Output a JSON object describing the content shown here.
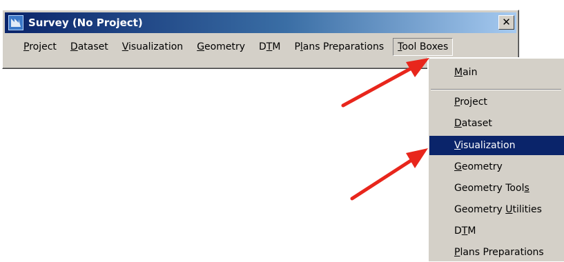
{
  "window": {
    "title": "Survey (No Project)",
    "close_glyph": "✕"
  },
  "menubar": {
    "items": [
      {
        "pre": "",
        "key": "P",
        "post": "roject"
      },
      {
        "pre": "",
        "key": "D",
        "post": "ataset"
      },
      {
        "pre": "",
        "key": "V",
        "post": "isualization"
      },
      {
        "pre": "",
        "key": "G",
        "post": "eometry"
      },
      {
        "pre": "D",
        "key": "T",
        "post": "M"
      },
      {
        "pre": "P",
        "key": "l",
        "post": "ans Preparations"
      },
      {
        "pre": "",
        "key": "T",
        "post": "ool Boxes"
      }
    ]
  },
  "dropdown": {
    "items": [
      {
        "pre": "",
        "key": "M",
        "post": "ain"
      },
      {
        "pre": "",
        "key": "P",
        "post": "roject"
      },
      {
        "pre": "",
        "key": "D",
        "post": "ataset"
      },
      {
        "pre": "",
        "key": "V",
        "post": "isualization"
      },
      {
        "pre": "",
        "key": "G",
        "post": "eometry"
      },
      {
        "pre": "Geometry Tool",
        "key": "s",
        "post": ""
      },
      {
        "pre": "Geometry ",
        "key": "U",
        "post": "tilities"
      },
      {
        "pre": "D",
        "key": "T",
        "post": "M"
      },
      {
        "pre": "",
        "key": "P",
        "post": "lans Preparations"
      }
    ],
    "selected": "Visualization"
  },
  "colors": {
    "title_gradient_start": "#0a246a",
    "selection": "#0a246a",
    "chrome": "#d4d0c8",
    "annotation_arrow": "#e8261c"
  },
  "icons": [
    "app-icon",
    "close-icon",
    "annotation-arrow"
  ]
}
